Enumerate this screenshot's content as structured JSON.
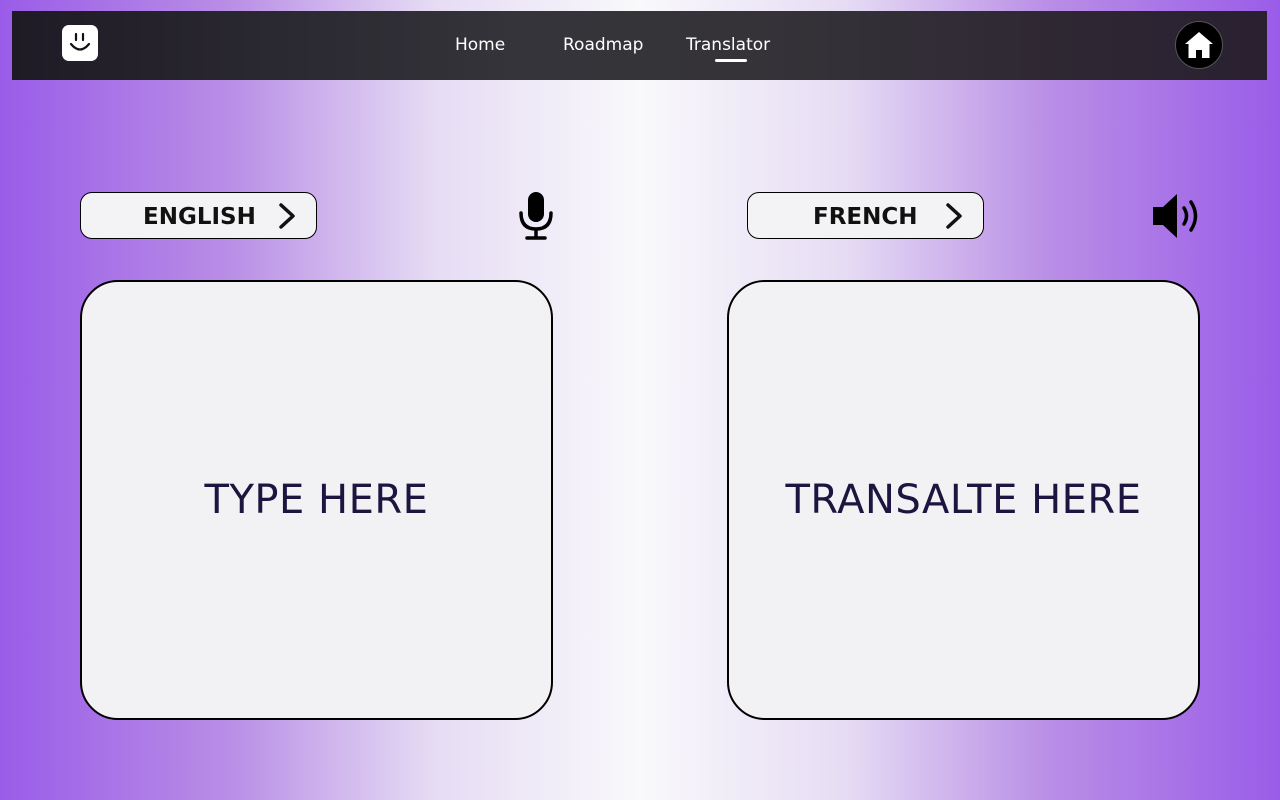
{
  "nav": {
    "links": [
      "Home",
      "Roadmap",
      "Translator"
    ],
    "active": "Translator"
  },
  "source": {
    "language": "ENGLISH",
    "placeholder": "TYPE HERE"
  },
  "target": {
    "language": "FRENCH",
    "placeholder": "TRANSALTE HERE"
  },
  "icons": {
    "logo": "smiley-icon",
    "home": "home-icon",
    "mic": "microphone-icon",
    "speaker": "speaker-icon",
    "chevron": "chevron-right-icon"
  },
  "colors": {
    "accent": "#9a5ce8",
    "navbar": "#2f2d33",
    "panel": "#f2f2f4",
    "panel_text": "#1d1440"
  }
}
